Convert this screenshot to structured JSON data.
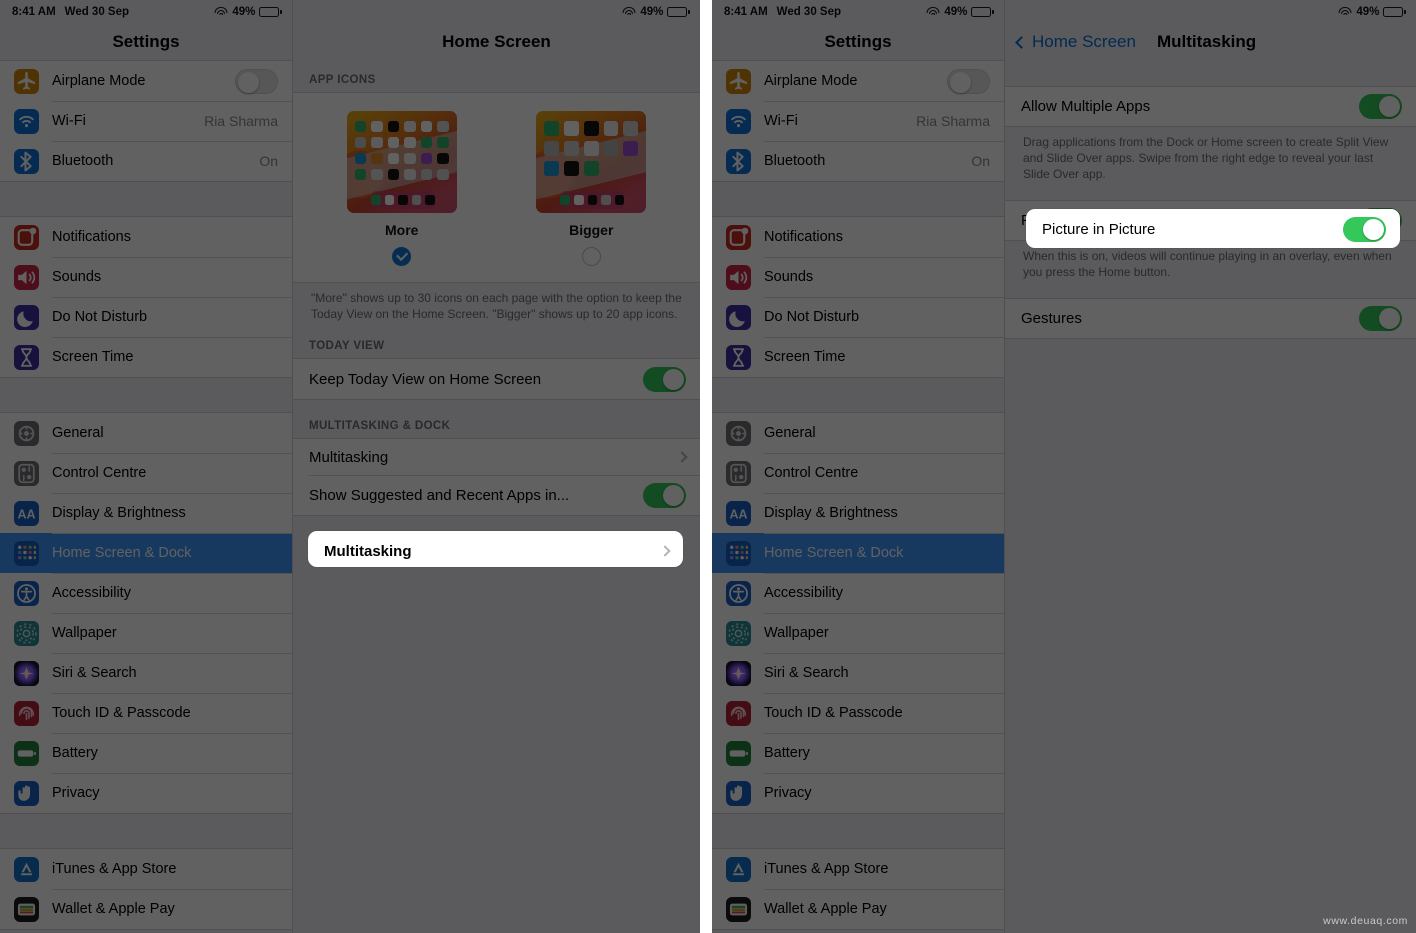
{
  "watermark": "www.deuaq.com",
  "status_bar": {
    "time": "8:41 AM",
    "date": "Wed 30 Sep",
    "battery": "49%",
    "wifi_icon": "wifi-icon",
    "battery_icon": "battery-icon"
  },
  "sidebar": {
    "title": "Settings",
    "groups": [
      {
        "items": [
          {
            "label": "Airplane Mode",
            "icon": "airplane-icon",
            "color": "#d3860f",
            "control": "toggle",
            "toggle": "off"
          },
          {
            "label": "Wi-Fi",
            "icon": "wifi-icon",
            "color": "#1071d8",
            "control": "value",
            "value": "Ria Sharma"
          },
          {
            "label": "Bluetooth",
            "icon": "bluetooth-icon",
            "color": "#1071d8",
            "control": "value",
            "value": "On"
          }
        ]
      },
      {
        "items": [
          {
            "label": "Notifications",
            "icon": "notifications-icon",
            "color": "#c62a21",
            "control": "none"
          },
          {
            "label": "Sounds",
            "icon": "sounds-icon",
            "color": "#cc2444",
            "control": "none"
          },
          {
            "label": "Do Not Disturb",
            "icon": "moon-icon",
            "color": "#3b2fa0",
            "control": "none"
          },
          {
            "label": "Screen Time",
            "icon": "hourglass-icon",
            "color": "#3b2fa0",
            "control": "none"
          }
        ]
      },
      {
        "items": [
          {
            "label": "General",
            "icon": "gear-icon",
            "color": "#6f6f74",
            "control": "none"
          },
          {
            "label": "Control Centre",
            "icon": "control-centre-icon",
            "color": "#6f6f74",
            "control": "none"
          },
          {
            "label": "Display & Brightness",
            "icon": "display-brightness-icon",
            "color": "#1a5fc4",
            "control": "none"
          },
          {
            "label": "Home Screen & Dock",
            "icon": "home-screen-dock-icon",
            "color": "#1a5fc4",
            "control": "none",
            "selected": true
          },
          {
            "label": "Accessibility",
            "icon": "accessibility-icon",
            "color": "#1a5fc4",
            "control": "none"
          },
          {
            "label": "Wallpaper",
            "icon": "wallpaper-icon",
            "color": "#2b8c93",
            "control": "none"
          },
          {
            "label": "Siri & Search",
            "icon": "siri-icon",
            "color": "#2a1f3d",
            "control": "none"
          },
          {
            "label": "Touch ID & Passcode",
            "icon": "touch-id-icon",
            "color": "#b4243c",
            "control": "none"
          },
          {
            "label": "Battery",
            "icon": "battery-icon",
            "color": "#21823a",
            "control": "none"
          },
          {
            "label": "Privacy",
            "icon": "privacy-hand-icon",
            "color": "#1a5fc4",
            "control": "none"
          }
        ]
      },
      {
        "items": [
          {
            "label": "iTunes & App Store",
            "icon": "app-store-icon",
            "color": "#1271c8",
            "control": "none"
          },
          {
            "label": "Wallet & Apple Pay",
            "icon": "wallet-icon",
            "color": "#1d1d1f",
            "control": "none"
          }
        ]
      }
    ]
  },
  "home_screen_pane": {
    "title": "Home Screen",
    "app_icons_header": "APP ICONS",
    "choosers": [
      {
        "label": "More",
        "selected": true
      },
      {
        "label": "Bigger",
        "selected": false
      }
    ],
    "app_icons_note": "\"More\" shows up to 30 icons on each page with the option to keep the Today View on the Home Screen. \"Bigger\" shows up to 20 app icons.",
    "today_view_header": "TODAY VIEW",
    "today_view_row": {
      "label": "Keep Today View on Home Screen",
      "toggle": "on"
    },
    "multitasking_header": "MULTITASKING & DOCK",
    "multitasking_row": {
      "label": "Multitasking",
      "chevron": "chevron-right-icon",
      "highlighted": true
    },
    "suggested_row": {
      "label": "Show Suggested and Recent Apps in...",
      "toggle": "on"
    }
  },
  "multitasking_pane": {
    "back_label": "Home Screen",
    "back_icon": "chevron-left-icon",
    "title": "Multitasking",
    "rows": [
      {
        "label": "Allow Multiple Apps",
        "toggle": "on",
        "highlighted": false
      },
      {
        "label": "Picture in Picture",
        "toggle": "on",
        "highlighted": true
      },
      {
        "label": "Gestures",
        "toggle": "on",
        "highlighted": false
      }
    ],
    "note_allow_multiple": "Drag applications from the Dock or Home screen to create Split View and Slide Over apps. Swipe from the right edge to reveal your last Slide Over app.",
    "note_pip": "When this is on, videos will continue playing in an overlay, even when you press the Home button."
  },
  "colors": {
    "accent_blue": "#3f95f9",
    "toggle_green": "#34c759",
    "link_blue": "#0a6ed7"
  }
}
